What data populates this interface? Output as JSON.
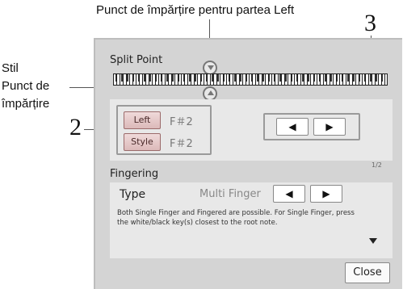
{
  "callouts": {
    "top": "Punct de împărțire pentru partea Left",
    "left_line1": "Stil",
    "left_line2": "Punct de",
    "left_line3": "împărțire",
    "num_2": "2",
    "num_3": "3"
  },
  "dialog": {
    "title": "Split Point",
    "left_button": "Left",
    "left_value": "F＃2",
    "style_button": "Style",
    "style_value": "F＃2",
    "arrow_left": "◀",
    "arrow_right": "▶",
    "page_indicator": "1/2",
    "fingering_title": "Fingering",
    "type_label": "Type",
    "type_value": "Multi Finger",
    "description": "Both Single Finger and Fingered are possible. For Single Finger, press the white/black key(s) closest to the root note.",
    "close_label": "Close"
  },
  "colors": {
    "panel": "#d4d4d4",
    "inner_box": "#e8e8e8",
    "part_button": "#e6c9c9"
  },
  "icons": {
    "split_marker_top": "triangle-down-icon",
    "split_marker_bottom": "triangle-up-icon",
    "scroll": "caret-down-icon"
  }
}
